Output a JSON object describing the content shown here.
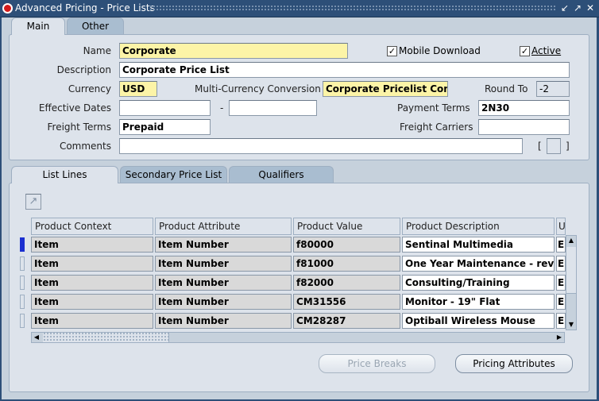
{
  "window": {
    "title": "Advanced Pricing - Price Lists",
    "min_icon": "minimize-icon",
    "max_icon": "maximize-icon",
    "close_icon": "close-icon"
  },
  "header_tabs": [
    {
      "label": "Main",
      "active": true
    },
    {
      "label": "Other",
      "active": false
    }
  ],
  "header": {
    "name_label": "Name",
    "name_value": "Corporate",
    "mobile_download_label": "Mobile Download",
    "mobile_download_checked": true,
    "active_label": "Active",
    "active_checked": true,
    "description_label": "Description",
    "description_value": "Corporate Price List",
    "currency_label": "Currency",
    "currency_value": "USD",
    "multicurrency_label": "Multi-Currency Conversion",
    "multicurrency_value": "Corporate Pricelist Conv",
    "round_to_label": "Round To",
    "round_to_value": "-2",
    "effective_dates_label": "Effective Dates",
    "effective_from": "",
    "date_separator": "-",
    "effective_to": "",
    "payment_terms_label": "Payment Terms",
    "payment_terms_value": "2N30",
    "freight_terms_label": "Freight Terms",
    "freight_terms_value": "Prepaid",
    "freight_carriers_label": "Freight Carriers",
    "freight_carriers_value": "",
    "comments_label": "Comments",
    "comments_value": "",
    "dff_open": "[",
    "dff_close": "]"
  },
  "lines_tabs": [
    {
      "label": "List Lines",
      "active": true
    },
    {
      "label": "Secondary Price List",
      "active": false
    },
    {
      "label": "Qualifiers",
      "active": false
    }
  ],
  "grid": {
    "columns": [
      "Product Context",
      "Product Attribute",
      "Product Value",
      "Product Description",
      "U"
    ],
    "rows": [
      {
        "context": "Item",
        "attribute": "Item Number",
        "value": "f80000",
        "description": "Sentinal Multimedia",
        "uom": "E"
      },
      {
        "context": "Item",
        "attribute": "Item Number",
        "value": "f81000",
        "description": "One Year Maintenance - reve",
        "uom": "E"
      },
      {
        "context": "Item",
        "attribute": "Item Number",
        "value": "f82000",
        "description": "Consulting/Training",
        "uom": "E"
      },
      {
        "context": "Item",
        "attribute": "Item Number",
        "value": "CM31556",
        "description": "Monitor - 19\" Flat",
        "uom": "E"
      },
      {
        "context": "Item",
        "attribute": "Item Number",
        "value": "CM28287",
        "description": "Optiball Wireless Mouse",
        "uom": "E"
      }
    ]
  },
  "buttons": {
    "price_breaks": "Price Breaks",
    "price_breaks_accel": "B",
    "pricing_attributes": "Pricing Attributes",
    "pricing_attributes_accel": "P"
  }
}
